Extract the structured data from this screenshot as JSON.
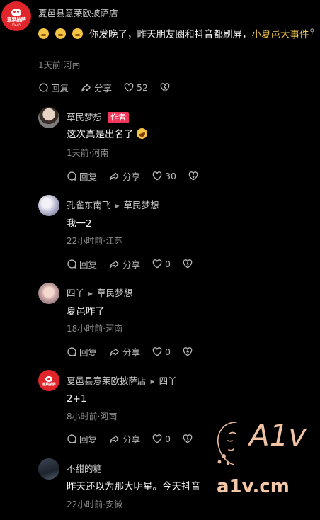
{
  "comments": [
    {
      "author": "夏邑县意莱欧披萨店",
      "avatar_text": "意莱披萨",
      "text_prefix": "你发晚了，昨天朋友圈和抖音都刷屏，",
      "text_link": "小夏邑大事件",
      "meta": "1天前·河南",
      "reply": "回复",
      "share": "分享",
      "likes": "52"
    },
    {
      "author": "草民梦想",
      "badge": "作者",
      "text": "这次真是出名了",
      "meta": "1天前·河南",
      "reply": "回复",
      "share": "分享",
      "likes": "30"
    },
    {
      "author": "孔雀东南飞",
      "reply_to": "草民梦想",
      "text": "我一2",
      "meta": "22小时前·江苏",
      "reply": "回复",
      "share": "分享",
      "likes": "0"
    },
    {
      "author": "四丫",
      "reply_to": "草民梦想",
      "text": "夏邑咋了",
      "meta": "18小时前·河南",
      "reply": "回复",
      "share": "分享",
      "likes": "0"
    },
    {
      "author": "夏邑县意莱欧披萨店",
      "reply_to": "四丫",
      "avatar_text": "意莱披萨",
      "text": "2+1",
      "meta": "8小时前·河南",
      "reply": "回复",
      "share": "分享",
      "likes": "0"
    },
    {
      "author": "不甜的糖",
      "text": "昨天还以为那大明星。今天抖音",
      "meta": "22小时前·安徽"
    }
  ],
  "watermark": {
    "logo": "A1v",
    "url": "a1v.cm"
  }
}
